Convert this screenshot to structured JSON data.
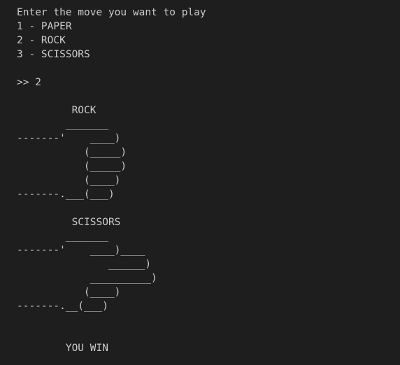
{
  "terminal": {
    "lines": [
      "Enter the move you want to play",
      "1 - PAPER",
      "2 - ROCK",
      "3 - SCISSORS",
      "",
      ">> 2",
      "",
      "         ROCK",
      "        _______",
      "-------'    ____)",
      "           (_____)",
      "           (_____)",
      "           (____)",
      "-------.___(___)",
      "",
      "         SCISSORS",
      "        _______",
      "-------'    ____)____",
      "               ______)",
      "            __________)",
      "           (____)",
      "-------.__(___)",
      "",
      "",
      "        YOU WIN"
    ]
  }
}
